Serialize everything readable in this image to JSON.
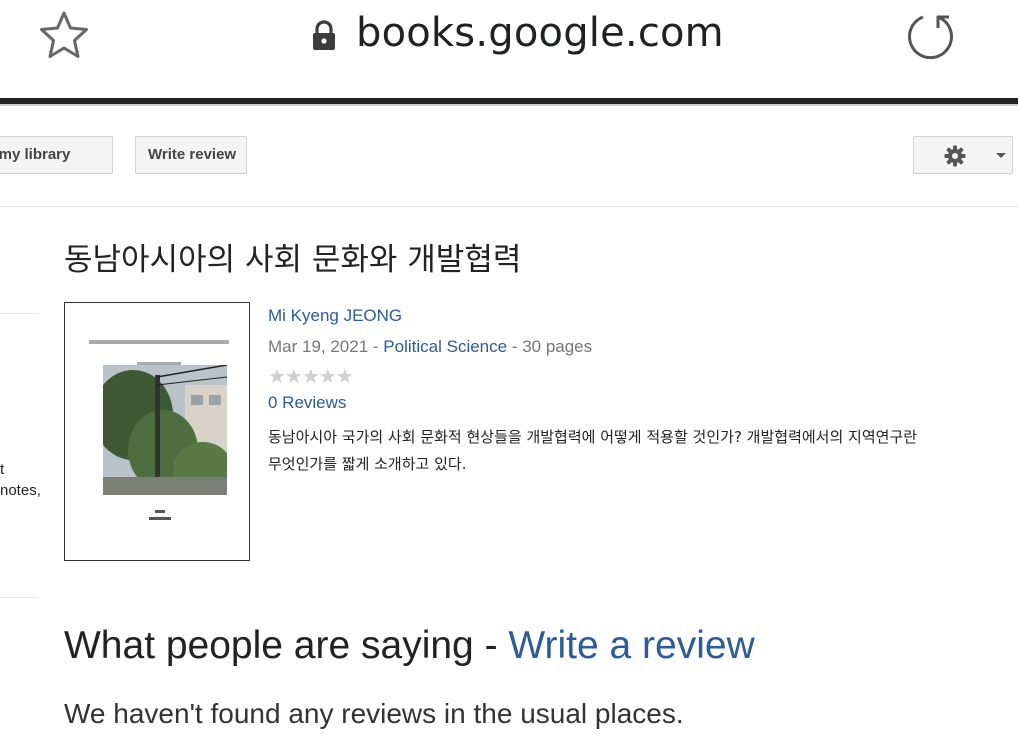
{
  "browser": {
    "url": "books.google.com",
    "icons": [
      "star-icon",
      "lock-icon",
      "reload-icon"
    ]
  },
  "toolbar": {
    "add_library_label": "d to my library",
    "write_review_label": "Write review",
    "settings_icons": [
      "gear-icon",
      "chevron-down-icon"
    ]
  },
  "sidebar": {
    "fragment1": "t",
    "fragment2": "notes,"
  },
  "book": {
    "title": "동남아시아의 사회 문화와 개발협력",
    "author": "Mi Kyeng JEONG",
    "date": "Mar 19, 2021",
    "sep1": " - ",
    "category": "Political Science",
    "sep2": " - ",
    "pages": "30 pages",
    "stars": "★★★★★",
    "rating": 0,
    "reviews_link": "0 Reviews",
    "description": "동남아시아 국가의 사회 문화적 현상들을 개발협력에 어떻게 적용할 것인가? 개발협력에서의 지역연구란 무엇인가를 짧게 소개하고 있다."
  },
  "reviews_section": {
    "heading_prefix": "What people are saying - ",
    "write_review_link": "Write a review",
    "empty_message": "We haven't found any reviews in the usual places."
  },
  "colors": {
    "link": "#2a5aa0",
    "meta": "#777777",
    "star_empty": "#cfcfcf"
  }
}
